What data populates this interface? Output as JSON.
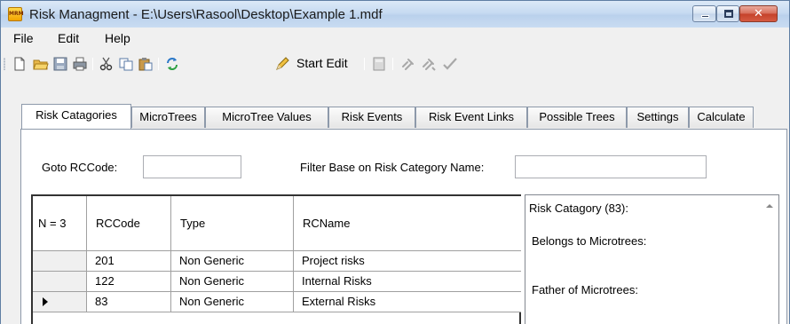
{
  "window": {
    "title": "Risk Managment - E:\\Users\\Rasool\\Desktop\\Example 1.mdf",
    "app_icon_text": "MRM",
    "close_glyph": "✕"
  },
  "menu": [
    {
      "label": "File"
    },
    {
      "label": "Edit"
    },
    {
      "label": "Help"
    }
  ],
  "toolbar": {
    "icons": [
      "new-icon",
      "open-folder-icon",
      "save-icon",
      "print-icon",
      "cut-icon",
      "copy-icon",
      "paste-icon",
      "refresh-icon",
      "pencil-icon",
      "calculator-icon",
      "link-icon",
      "unlink-icon",
      "check-icon"
    ],
    "start_edit_label": "Start Edit"
  },
  "tabs": [
    {
      "label": "Risk Catagories",
      "active": true
    },
    {
      "label": "MicroTrees"
    },
    {
      "label": "MicroTree Values"
    },
    {
      "label": "Risk Events"
    },
    {
      "label": "Risk Event Links"
    },
    {
      "label": "Possible Trees"
    },
    {
      "label": "Settings"
    },
    {
      "label": "Calculate"
    }
  ],
  "filters": {
    "goto_label": "Goto RCCode:",
    "goto_value": "",
    "filter_label": "Filter Base on Risk Category Name:",
    "filter_value": ""
  },
  "grid": {
    "row_header_label": "N = 3",
    "columns": [
      "RCCode",
      "Type",
      "RCName"
    ],
    "rows": [
      {
        "code": "201",
        "type": "Non Generic",
        "name": "Project risks",
        "current": false
      },
      {
        "code": "122",
        "type": "Non Generic",
        "name": "Internal Risks",
        "current": false
      },
      {
        "code": "83",
        "type": "Non Generic",
        "name": "External Risks",
        "current": true
      }
    ]
  },
  "info_panel": {
    "title": "Risk Catagory (83):",
    "belongs_label": "Belongs to Microtrees:",
    "father_label": "Father of Microtrees:"
  },
  "colors": {
    "titlebar": "#c6daf1",
    "window_bg": "#f0f0f0",
    "close_button": "#c4422a",
    "tab_border": "#8d99aa"
  }
}
